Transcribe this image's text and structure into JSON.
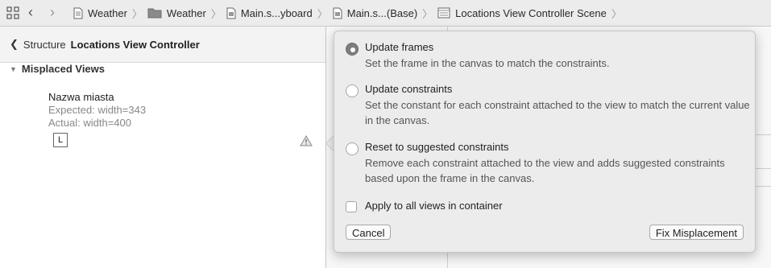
{
  "jumpbar": {
    "crumbs": [
      {
        "label": "Weather",
        "icon": "file-icon"
      },
      {
        "label": "Weather",
        "icon": "folder-icon"
      },
      {
        "label": "Main.s...yboard",
        "icon": "storyboard-icon"
      },
      {
        "label": "Main.s...(Base)",
        "icon": "storyboard-icon"
      },
      {
        "label": "Locations View Controller Scene",
        "icon": "scene-icon"
      }
    ]
  },
  "left_panel": {
    "back_label": "Structure",
    "title": "Locations View Controller",
    "section_title": "Misplaced Views",
    "item": {
      "name": "Nazwa miasta",
      "expected": "Expected: width=343",
      "actual": "Actual: width=400",
      "badge": "L"
    }
  },
  "popover": {
    "options": [
      {
        "title": "Update frames",
        "desc": "Set the frame in the canvas to match the constraints.",
        "selected": true
      },
      {
        "title": "Update constraints",
        "desc": "Set the constant for each constraint attached to the view to match the current value in the canvas.",
        "selected": false
      },
      {
        "title": "Reset to suggested constraints",
        "desc": "Remove each constraint attached to the view and adds suggested constraints based upon the frame in the canvas.",
        "selected": false
      }
    ],
    "checkbox_label": "Apply to all views in container",
    "cancel_label": "Cancel",
    "fix_label": "Fix Misplacement"
  }
}
